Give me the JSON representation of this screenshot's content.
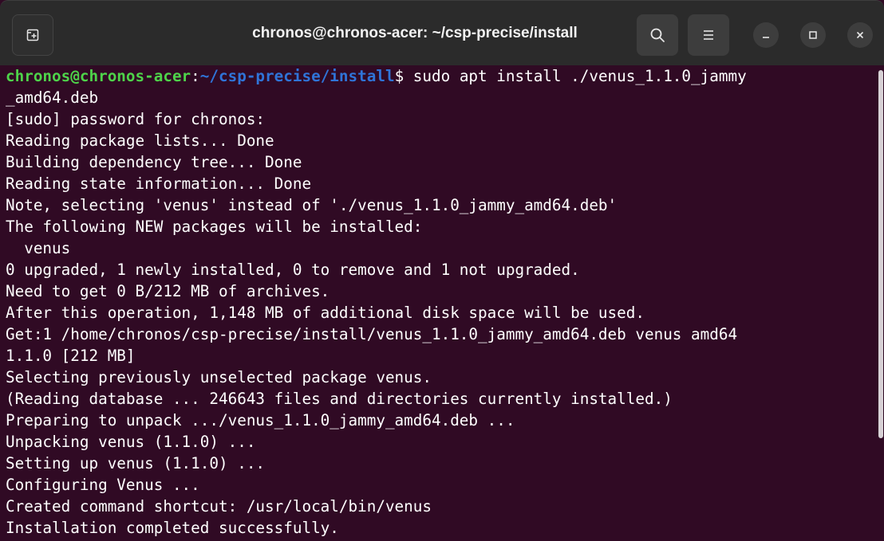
{
  "window": {
    "title": "chronos@chronos-acer: ~/csp-precise/install",
    "background": "#300a24",
    "titlebar_color": "#2b2b2b"
  },
  "icons": {
    "new_tab": "new-tab-icon",
    "search": "search-icon",
    "menu": "hamburger-menu-icon",
    "minimize": "minimize-icon",
    "maximize": "maximize-icon",
    "close": "close-icon"
  },
  "prompt": {
    "user": "chronos@chronos-acer",
    "sep": ":",
    "path": "~/csp-precise/install",
    "symbol": "$",
    "command": " sudo apt install ./venus_1.1.0_jammy"
  },
  "output": [
    "_amd64.deb",
    "[sudo] password for chronos:",
    "Reading package lists... Done",
    "Building dependency tree... Done",
    "Reading state information... Done",
    "Note, selecting 'venus' instead of './venus_1.1.0_jammy_amd64.deb'",
    "The following NEW packages will be installed:",
    "  venus",
    "0 upgraded, 1 newly installed, 0 to remove and 1 not upgraded.",
    "Need to get 0 B/212 MB of archives.",
    "After this operation, 1,148 MB of additional disk space will be used.",
    "Get:1 /home/chronos/csp-precise/install/venus_1.1.0_jammy_amd64.deb venus amd64",
    "1.1.0 [212 MB]",
    "Selecting previously unselected package venus.",
    "(Reading database ... 246643 files and directories currently installed.)",
    "Preparing to unpack .../venus_1.1.0_jammy_amd64.deb ...",
    "Unpacking venus (1.1.0) ...",
    "Setting up venus (1.1.0) ...",
    "Configuring Venus ...",
    "Created command shortcut: /usr/local/bin/venus",
    "Installation completed successfully."
  ],
  "colors": {
    "user": "#4ed34a",
    "path": "#2f74d8",
    "text": "#ffffff"
  }
}
